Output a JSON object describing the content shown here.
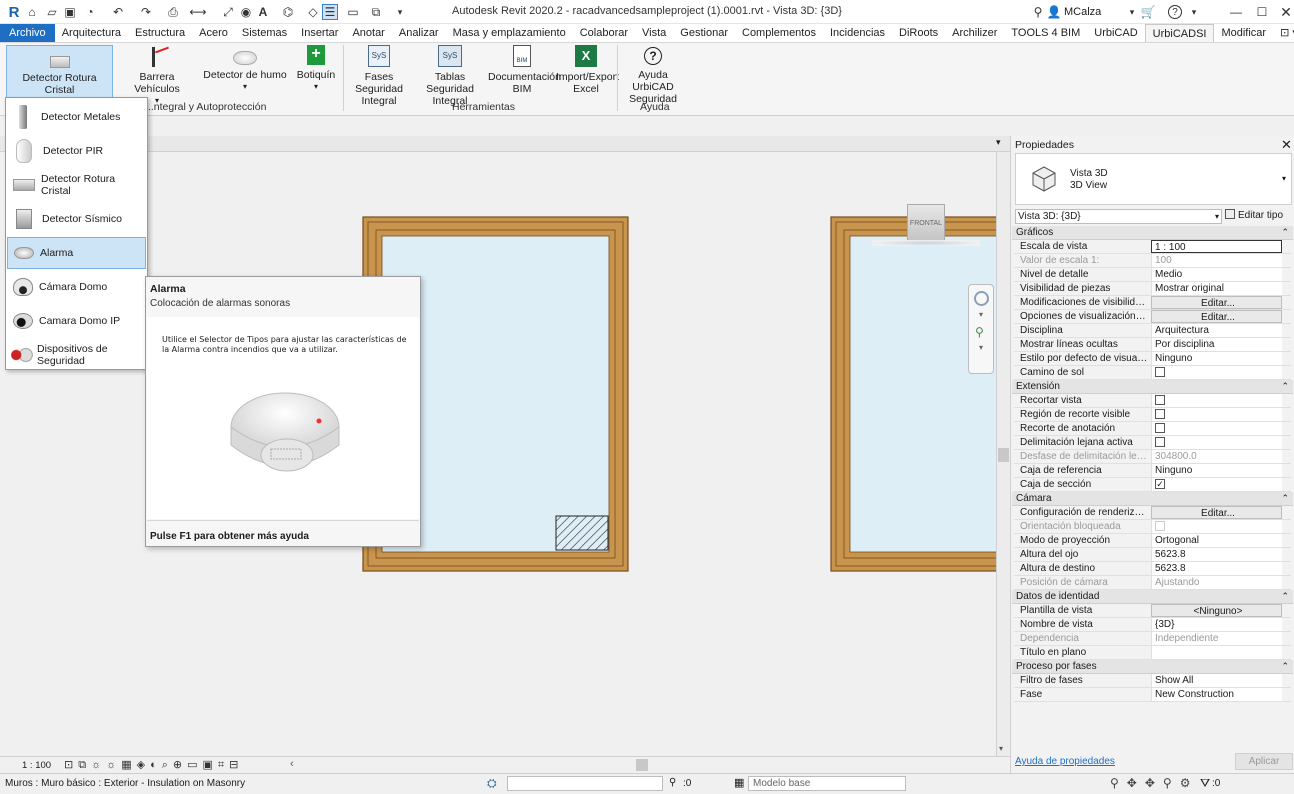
{
  "titlebar": {
    "app_letter": "R",
    "window_title": "Autodesk Revit 2020.2 - racadvancedsampleproject (1).0001.rvt - Vista 3D: {3D}",
    "user": "MCalza"
  },
  "menu": [
    "Archivo",
    "Arquitectura",
    "Estructura",
    "Acero",
    "Sistemas",
    "Insertar",
    "Anotar",
    "Analizar",
    "Masa y emplazamiento",
    "Colaborar",
    "Vista",
    "Gestionar",
    "Complementos",
    "Incidencias",
    "DiRoots",
    "Archilizer",
    "TOOLS 4 BIM",
    "UrbiCAD",
    "UrbiCADSI",
    "Modificar"
  ],
  "ribbon": {
    "buttons": {
      "detector_rotura": "Detector Rotura Cristal",
      "barrera": "Barrera Vehículos",
      "detector_humo": "Detector de humo",
      "botiquin": "Botiquín",
      "fases": "Fases Seguridad Integral",
      "tablas": "Tablas Seguridad Integral",
      "documentacion": "Documentación BIM",
      "import_export": "Import/Export Excel",
      "ayuda_urbicad": "Ayuda UrbiCAD Seguridad"
    },
    "groups": {
      "seguridad": "...ntegral y Autoprotección",
      "herramientas": "Herramientas",
      "ayuda": "Ayuda"
    }
  },
  "dropdown": {
    "items": [
      "Detector Metales",
      "Detector PIR",
      "Detector Rotura Cristal",
      "Detector Sísmico",
      "Alarma",
      "Cámara Domo",
      "Camara Domo IP",
      "Dispositivos de Seguridad"
    ],
    "selected": "Alarma"
  },
  "tooltip": {
    "title": "Alarma",
    "subtitle": "Colocación de alarmas sonoras",
    "body": "Utilice el Selector de Tipos para ajustar las características de la Alarma contra incendios que va a utilizar.",
    "footer": "Pulse F1 para obtener más ayuda"
  },
  "canvas": {
    "viewcube_label": "FRONTAL"
  },
  "properties": {
    "title": "Propiedades",
    "type_name": "Vista 3D",
    "type_sub": "3D View",
    "selector": "Vista 3D: {3D}",
    "edit_type": "Editar tipo",
    "sections": [
      {
        "name": "Gráficos",
        "rows": [
          {
            "k": "Escala de vista",
            "v": "1 : 100",
            "style": "boxed"
          },
          {
            "k": "Valor de escala    1:",
            "v": "100",
            "style": "dim"
          },
          {
            "k": "Nivel de detalle",
            "v": "Medio"
          },
          {
            "k": "Visibilidad de piezas",
            "v": "Mostrar original"
          },
          {
            "k": "Modificaciones de visibilidad/...",
            "v": "Editar...",
            "style": "btn"
          },
          {
            "k": "Opciones de visualización de ...",
            "v": "Editar...",
            "style": "btn"
          },
          {
            "k": "Disciplina",
            "v": "Arquitectura"
          },
          {
            "k": "Mostrar líneas ocultas",
            "v": "Por disciplina"
          },
          {
            "k": "Estilo por defecto de visualiza...",
            "v": "Ninguno"
          },
          {
            "k": "Camino de sol",
            "v": "",
            "style": "chk"
          }
        ]
      },
      {
        "name": "Extensión",
        "rows": [
          {
            "k": "Recortar vista",
            "v": "",
            "style": "chk"
          },
          {
            "k": "Región de recorte visible",
            "v": "",
            "style": "chk"
          },
          {
            "k": "Recorte de anotación",
            "v": "",
            "style": "chk"
          },
          {
            "k": "Delimitación lejana activa",
            "v": "",
            "style": "chk"
          },
          {
            "k": "Desfase de delimitación lejano",
            "v": "304800.0",
            "style": "dim"
          },
          {
            "k": "Caja de referencia",
            "v": "Ninguno"
          },
          {
            "k": "Caja de sección",
            "v": "✓",
            "style": "chk"
          }
        ]
      },
      {
        "name": "Cámara",
        "rows": [
          {
            "k": "Configuración de renderización",
            "v": "Editar...",
            "style": "btn"
          },
          {
            "k": "Orientación bloqueada",
            "v": "",
            "style": "dimchk"
          },
          {
            "k": "Modo de proyección",
            "v": "Ortogonal"
          },
          {
            "k": "Altura del ojo",
            "v": "5623.8"
          },
          {
            "k": "Altura de destino",
            "v": "5623.8"
          },
          {
            "k": "Posición de cámara",
            "v": "Ajustando",
            "style": "dim"
          }
        ]
      },
      {
        "name": "Datos de identidad",
        "rows": [
          {
            "k": "Plantilla de vista",
            "v": "<Ninguno>",
            "style": "btn"
          },
          {
            "k": "Nombre de vista",
            "v": "{3D}"
          },
          {
            "k": "Dependencia",
            "v": "Independiente",
            "style": "dim"
          },
          {
            "k": "Título en plano",
            "v": ""
          }
        ]
      },
      {
        "name": "Proceso por fases",
        "rows": [
          {
            "k": "Filtro de fases",
            "v": "Show All"
          },
          {
            "k": "Fase",
            "v": "New Construction"
          }
        ]
      }
    ],
    "help_link": "Ayuda de propiedades",
    "apply": "Aplicar"
  },
  "view_control": {
    "scale": "1 : 100"
  },
  "statusbar": {
    "text": "Muros : Muro básico : Exterior - Insulation on Masonry",
    "count": ":0",
    "model": "Modelo base",
    "filter_count": ":0"
  },
  "colors": {
    "accent": "#1e6fc4",
    "wall": "#c8954e",
    "wall_edge": "#7a4a1a",
    "room": "#ddeef7"
  }
}
